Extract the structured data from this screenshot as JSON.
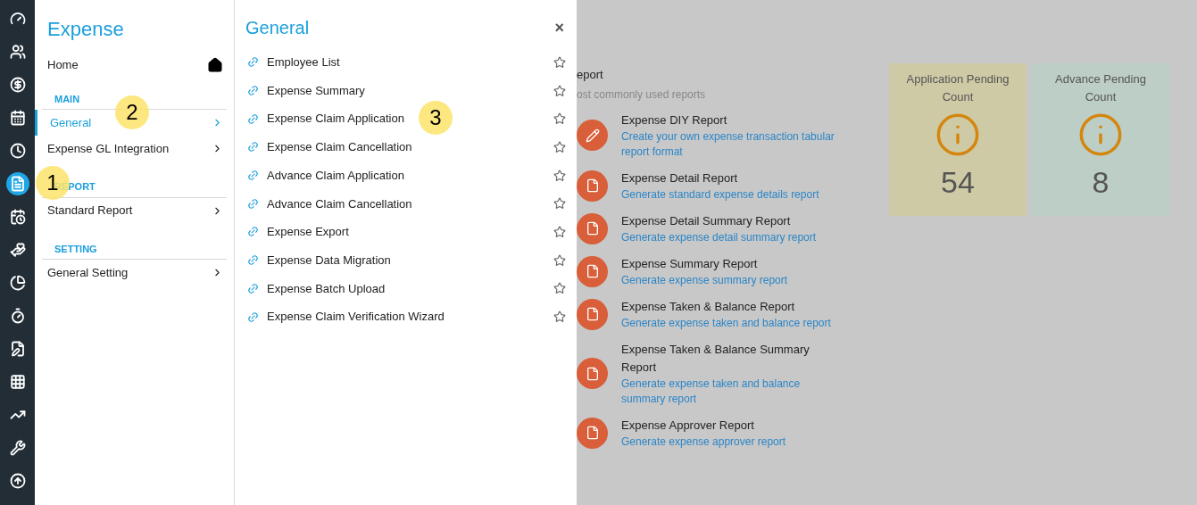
{
  "rail": [
    {
      "selected": false
    },
    {
      "selected": false
    },
    {
      "selected": false
    },
    {
      "selected": false
    },
    {
      "selected": false
    },
    {
      "selected": true
    },
    {
      "selected": false
    },
    {
      "selected": false
    },
    {
      "selected": false
    },
    {
      "selected": false
    },
    {
      "selected": false
    },
    {
      "selected": false
    },
    {
      "selected": false
    },
    {
      "selected": false
    },
    {
      "selected": false
    }
  ],
  "module": {
    "title": "Expense",
    "home": "Home",
    "sections": [
      {
        "heading": "MAIN",
        "items": [
          {
            "label": "General",
            "selected": true
          },
          {
            "label": "Expense GL Integration",
            "selected": false
          }
        ]
      },
      {
        "heading": "REPORT",
        "items": [
          {
            "label": "Standard Report",
            "selected": false
          }
        ]
      },
      {
        "heading": "SETTING",
        "items": [
          {
            "label": "General Setting",
            "selected": false
          }
        ]
      }
    ]
  },
  "submenu": {
    "title": "General",
    "close": "×",
    "items": [
      {
        "label": "Employee List",
        "starred": false
      },
      {
        "label": "Expense Summary",
        "starred": false
      },
      {
        "label": "Expense Claim Application",
        "starred": false
      },
      {
        "label": "Expense Claim Cancellation",
        "starred": false
      },
      {
        "label": "Advance Claim Application",
        "starred": false
      },
      {
        "label": "Advance Claim Cancellation",
        "starred": false
      },
      {
        "label": "Expense Export",
        "starred": false
      },
      {
        "label": "Expense Data Migration",
        "starred": false
      },
      {
        "label": "Expense Batch Upload",
        "starred": false
      },
      {
        "label": "Expense Claim Verification Wizard",
        "starred": false
      }
    ]
  },
  "reports": {
    "title": "eport",
    "subtitle": "ost commonly used reports",
    "items": [
      {
        "kind": "pen",
        "name": "Expense DIY Report",
        "description": "Create your own expense transaction tabular report format"
      },
      {
        "kind": "file",
        "name": "Expense Detail Report",
        "description": "Generate standard expense details report"
      },
      {
        "kind": "file",
        "name": "Expense Detail Summary Report",
        "description": "Generate expense detail summary report"
      },
      {
        "kind": "file",
        "name": "Expense Summary Report",
        "description": "Generate expense summary report"
      },
      {
        "kind": "file",
        "name": "Expense Taken & Balance Report",
        "description": "Generate expense taken and balance report"
      },
      {
        "kind": "file",
        "name": "Expense Taken & Balance Summary Report",
        "description": "Generate expense taken and balance summary report"
      },
      {
        "kind": "file",
        "name": "Expense Approver Report",
        "description": "Generate expense approver report"
      }
    ]
  },
  "cards": [
    {
      "label": "Application Pending Count",
      "value": "54",
      "color": "#cfcaa6"
    },
    {
      "label": "Advance Pending Count",
      "value": "8",
      "color": "#bdcec6"
    }
  ],
  "callouts": [
    "1",
    "2",
    "3"
  ]
}
